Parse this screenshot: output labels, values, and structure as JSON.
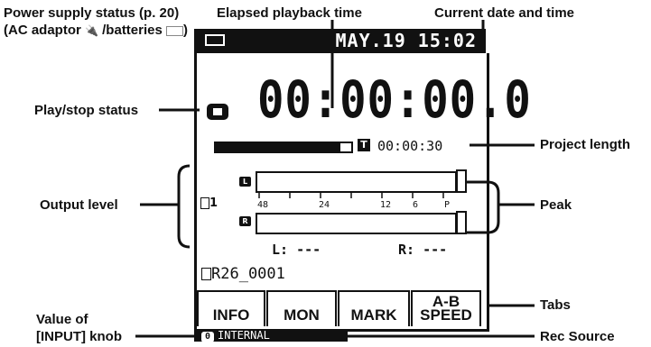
{
  "callouts": {
    "power": "Power supply status (p. 20)",
    "power_sub_a": "(AC adaptor",
    "power_sub_b": "/batteries",
    "elapsed": "Elapsed playback time",
    "datetime": "Current date and time",
    "playstop": "Play/stop status",
    "project_length": "Project length",
    "output_level": "Output level",
    "peak": "Peak",
    "tabs": "Tabs",
    "value_input_1": "Value of",
    "value_input_2": "[INPUT] knob",
    "rec_source": "Rec Source"
  },
  "screen": {
    "datetime": "MAY.19 15:02",
    "timecode": "00:00:00.0",
    "project_length": "00:00:30",
    "t_label": "T",
    "channel": "1",
    "scale": [
      "48",
      "24",
      "12",
      "6",
      "P"
    ],
    "left_label": "L:",
    "left_value": "---",
    "right_label": "R:",
    "right_value": "---",
    "filename": "R26_0001",
    "tabs": [
      "INFO",
      "MON",
      "MARK"
    ],
    "speed_tab_top": "A-B",
    "speed_tab_bottom": "SPEED",
    "knob_value": "0",
    "rec_source": "INTERNAL",
    "meter_L": "L",
    "meter_R": "R",
    "progress_fraction": 0.92
  }
}
